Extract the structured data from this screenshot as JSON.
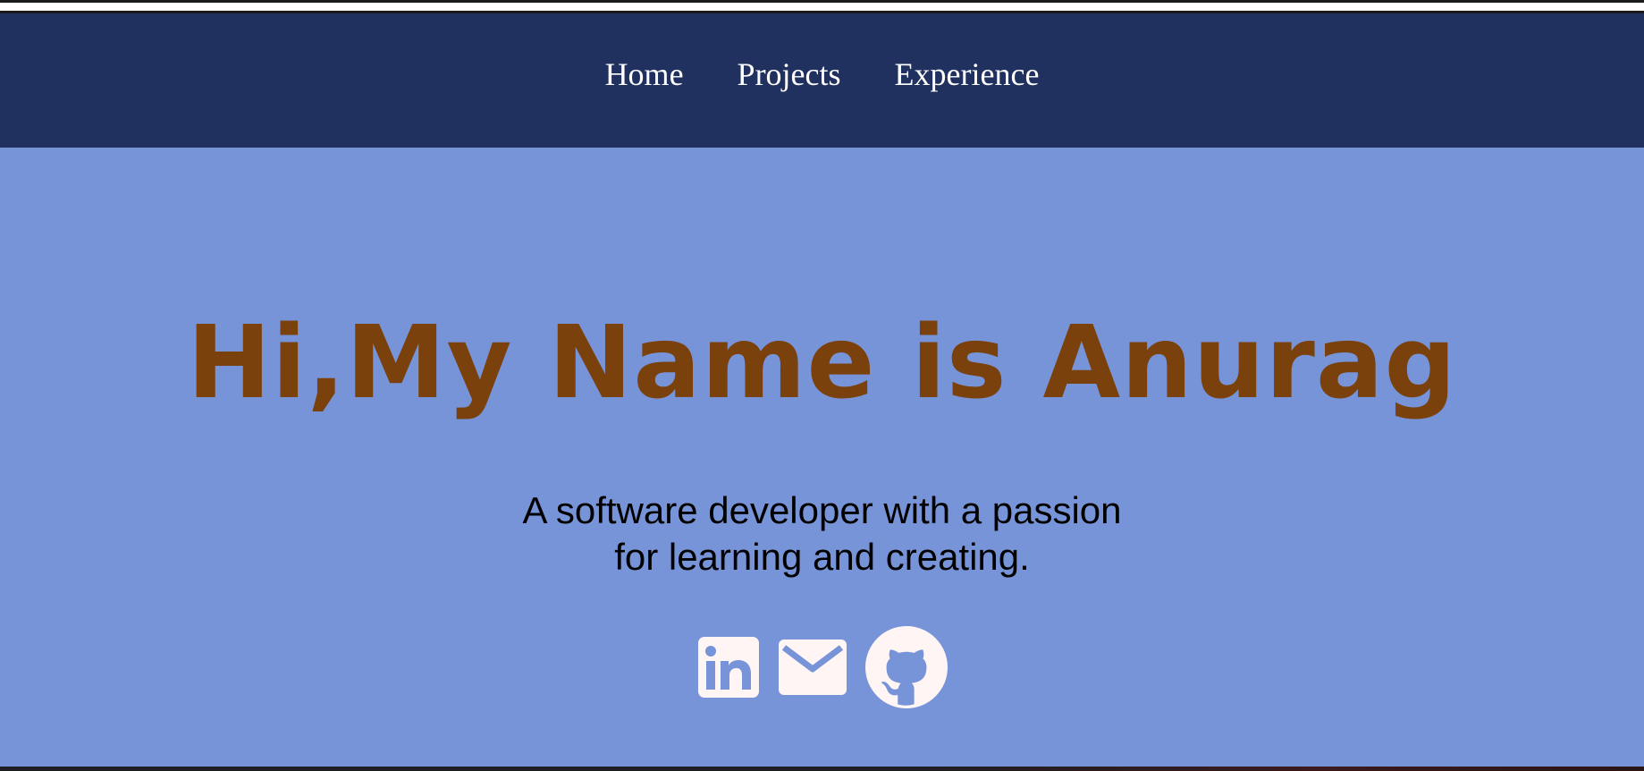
{
  "nav": {
    "items": [
      {
        "label": "Home"
      },
      {
        "label": "Projects"
      },
      {
        "label": "Experience"
      }
    ]
  },
  "hero": {
    "title": "Hi,My Name is Anurag",
    "subtitle_line1": "A software developer with a passion",
    "subtitle_line2": "for learning and creating."
  },
  "social": {
    "icons": [
      "linkedin-icon",
      "email-icon",
      "github-icon"
    ]
  },
  "colors": {
    "navbar_bg": "#21315f",
    "hero_bg": "#7894d8",
    "title_color": "#7a410c",
    "icon_color": "#fff5f5"
  }
}
